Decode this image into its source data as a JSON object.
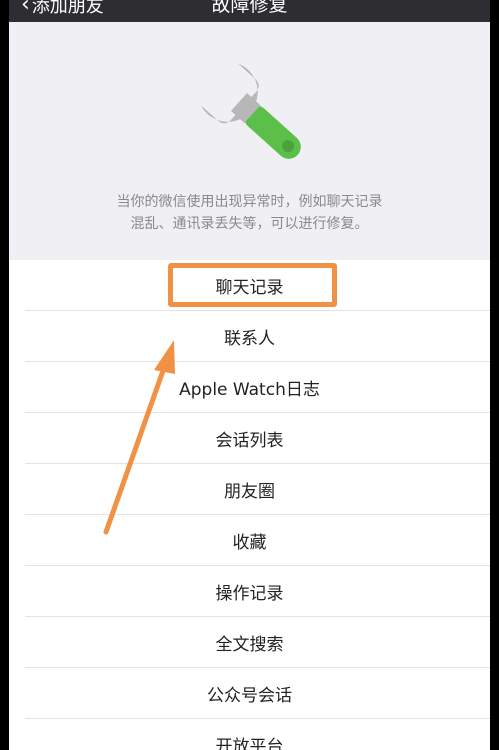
{
  "nav": {
    "back_label": "添加朋友",
    "title": "故障修复"
  },
  "header": {
    "description": "当你的微信使用出现异常时，例如聊天记录\n混乱、通讯录丢失等，可以进行修复。"
  },
  "repair_items": [
    {
      "label": "聊天记录"
    },
    {
      "label": "联系人"
    },
    {
      "label": "Apple Watch日志"
    },
    {
      "label": "会话列表"
    },
    {
      "label": "朋友圈"
    },
    {
      "label": "收藏"
    },
    {
      "label": "操作记录"
    },
    {
      "label": "全文搜索"
    },
    {
      "label": "公众号会话"
    },
    {
      "label": "开放平台"
    }
  ],
  "colors": {
    "nav_bg": "#2e2e32",
    "header_bg": "#efeff4",
    "annotation": "#f19145",
    "wrench_handle": "#5bbf4a",
    "wrench_head": "#b7b7b7"
  },
  "icons": {
    "repair": "wrench-icon",
    "back": "chevron-left-icon"
  }
}
